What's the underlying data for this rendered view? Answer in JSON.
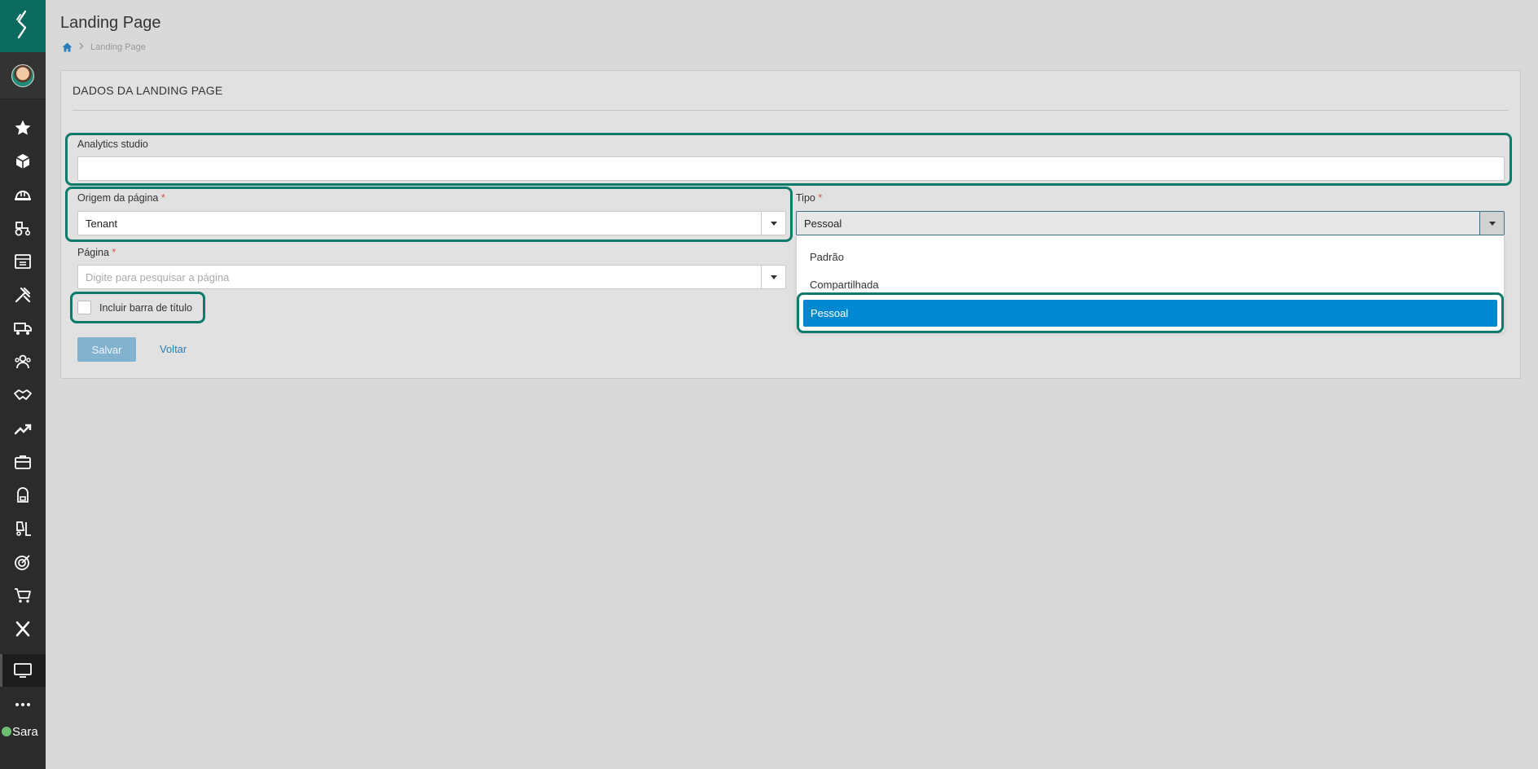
{
  "header": {
    "title": "Landing Page",
    "breadcrumb": {
      "home_icon": "home-icon",
      "current": "Landing Page"
    }
  },
  "panel": {
    "title": "DADOS DA LANDING PAGE"
  },
  "form": {
    "analytics_studio": {
      "label": "Analytics studio",
      "value": ""
    },
    "origem": {
      "label": "Origem da página",
      "required_mark": "*",
      "value": "Tenant"
    },
    "tipo": {
      "label": "Tipo",
      "required_mark": "*",
      "value": "Pessoal",
      "options": [
        "Padrão",
        "Compartilhada",
        "Pessoal"
      ],
      "selected_index": 2
    },
    "pagina": {
      "label": "Página",
      "required_mark": "*",
      "placeholder": "Digite para pesquisar a página"
    },
    "incluir_barra": {
      "label": "Incluir barra de título",
      "checked": false
    },
    "save_label": "Salvar",
    "back_label": "Voltar"
  },
  "sidebar": {
    "logo_icon": "logo-icon",
    "items": [
      "star-icon",
      "cube-icon",
      "helmet-icon",
      "tractor-icon",
      "archive-icon",
      "tools-icon",
      "truck-icon",
      "team-icon",
      "handshake-icon",
      "trend-up-icon",
      "briefcase-icon",
      "backpack-icon",
      "forklift-icon",
      "target-icon",
      "cart-icon",
      "close-x-icon",
      "monitor-icon",
      "more-icon"
    ],
    "active_item": "monitor-icon",
    "assistant_label": "Sara"
  },
  "colors": {
    "accent_teal": "#0c7b6a",
    "sidebar_bg": "#2b2b2b",
    "logo_bg": "#0c6b5f",
    "selected_option": "#0089d1",
    "save_button": "#83b2cf",
    "link": "#2a7fb8"
  }
}
